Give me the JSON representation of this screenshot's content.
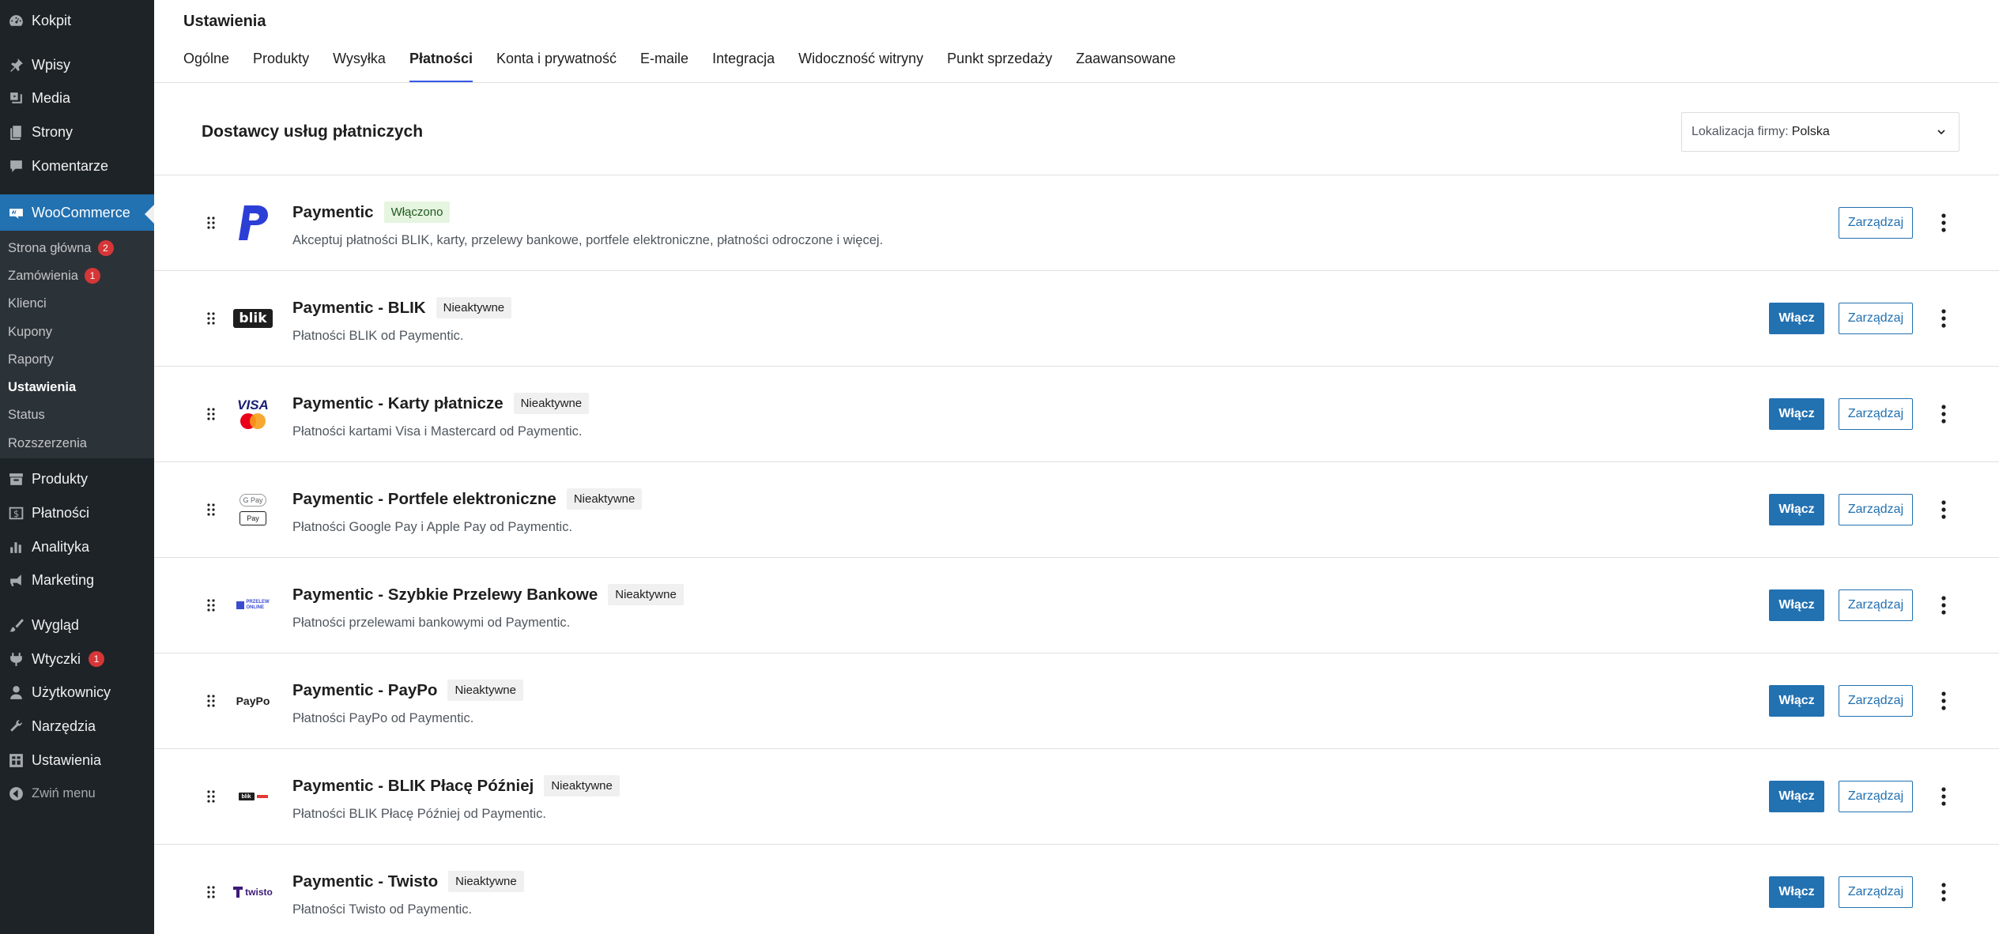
{
  "sidebar": {
    "items": [
      {
        "label": "Kokpit",
        "icon": "dashboard-icon"
      },
      {
        "label": "Wpisy",
        "icon": "pin-icon"
      },
      {
        "label": "Media",
        "icon": "media-icon"
      },
      {
        "label": "Strony",
        "icon": "pages-icon"
      },
      {
        "label": "Komentarze",
        "icon": "comments-icon"
      },
      {
        "label": "WooCommerce",
        "icon": "woocommerce-icon"
      },
      {
        "label": "Produkty",
        "icon": "archive-icon"
      },
      {
        "label": "Płatności",
        "icon": "payments-icon"
      },
      {
        "label": "Analityka",
        "icon": "chart-icon"
      },
      {
        "label": "Marketing",
        "icon": "megaphone-icon"
      },
      {
        "label": "Wygląd",
        "icon": "brush-icon"
      },
      {
        "label": "Wtyczki",
        "icon": "plugin-icon",
        "badge": "1"
      },
      {
        "label": "Użytkownicy",
        "icon": "users-icon"
      },
      {
        "label": "Narzędzia",
        "icon": "wrench-icon"
      },
      {
        "label": "Ustawienia",
        "icon": "settings-icon"
      }
    ],
    "submenu": [
      {
        "label": "Strona główna",
        "badge": "2"
      },
      {
        "label": "Zamówienia",
        "badge": "1"
      },
      {
        "label": "Klienci"
      },
      {
        "label": "Kupony"
      },
      {
        "label": "Raporty"
      },
      {
        "label": "Ustawienia"
      },
      {
        "label": "Status"
      },
      {
        "label": "Rozszerzenia"
      }
    ],
    "collapse_label": "Zwiń menu"
  },
  "header": {
    "title": "Ustawienia",
    "tabs": [
      "Ogólne",
      "Produkty",
      "Wysyłka",
      "Płatności",
      "Konta i prywatność",
      "E-maile",
      "Integracja",
      "Widoczność witryny",
      "Punkt sprzedaży",
      "Zaawansowane"
    ],
    "active_tab": "Płatności"
  },
  "section": {
    "title": "Dostawcy usług płatniczych",
    "location_label": "Lokalizacja firmy:",
    "location_value": "Polska"
  },
  "buttons": {
    "enable": "Włącz",
    "manage": "Zarządzaj"
  },
  "providers": [
    {
      "name": "Paymentic",
      "status": "Włączono",
      "desc": "Akceptuj płatności BLIK, karty, przelewy bankowe, portfele elektroniczne, płatności odroczone i więcej.",
      "logo": "paymentic-logo-icon"
    },
    {
      "name": "Paymentic - BLIK",
      "status": "Nieaktywne",
      "desc": "Płatności BLIK od Paymentic.",
      "logo": "blik-logo-icon",
      "logo_text": "blik"
    },
    {
      "name": "Paymentic - Karty płatnicze",
      "status": "Nieaktywne",
      "desc": "Płatności kartami Visa i Mastercard od Paymentic.",
      "logo": "visa-mastercard-logo-icon",
      "logo_text": "VISA"
    },
    {
      "name": "Paymentic - Portfele elektroniczne",
      "status": "Nieaktywne",
      "desc": "Płatności Google Pay i Apple Pay od Paymentic.",
      "logo": "gpay-applepay-logo-icon",
      "logo_text": "G Pay",
      "logo_text2": "Pay"
    },
    {
      "name": "Paymentic - Szybkie Przelewy Bankowe",
      "status": "Nieaktywne",
      "desc": "Płatności przelewami bankowymi od Paymentic.",
      "logo": "przelew-online-logo-icon",
      "logo_text": "PRZELEW",
      "logo_text2": "ONLINE"
    },
    {
      "name": "Paymentic - PayPo",
      "status": "Nieaktywne",
      "desc": "Płatności PayPo od Paymentic.",
      "logo": "paypo-logo-icon",
      "logo_text": "PayPo"
    },
    {
      "name": "Paymentic - BLIK Płacę Później",
      "status": "Nieaktywne",
      "desc": "Płatności BLIK Płacę Później od Paymentic.",
      "logo": "blik-later-logo-icon",
      "logo_text": "blik"
    },
    {
      "name": "Paymentic - Twisto",
      "status": "Nieaktywne",
      "desc": "Płatności Twisto od Paymentic.",
      "logo": "twisto-logo-icon",
      "logo_text": "twisto"
    }
  ],
  "colors": {
    "accent": "#2271b1",
    "sidebar_bg": "#1d2327",
    "tab_indicator": "#3858e9",
    "enabled_badge_bg": "#e5f5e0"
  }
}
